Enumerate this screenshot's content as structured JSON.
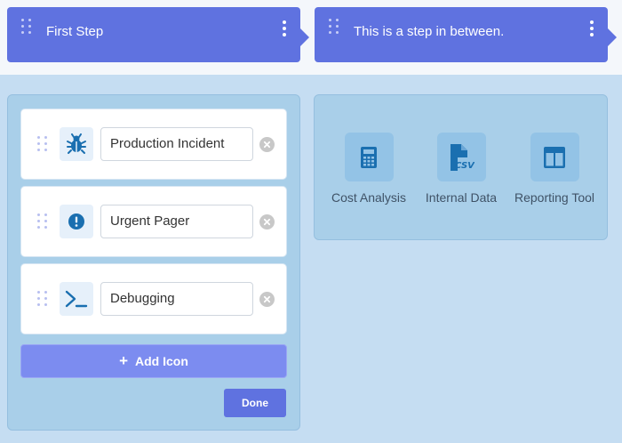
{
  "steps": [
    {
      "label": "First Step"
    },
    {
      "label": "This is a step in between."
    }
  ],
  "icon_list": {
    "items": [
      {
        "icon": "bug-icon",
        "value": "Production Incident"
      },
      {
        "icon": "exclamation-circle-icon",
        "value": "Urgent Pager"
      },
      {
        "icon": "terminal-icon",
        "value": "Debugging"
      }
    ],
    "add_label": "Add Icon",
    "done_label": "Done"
  },
  "tools": [
    {
      "icon": "calculator-icon",
      "label": "Cost Analysis"
    },
    {
      "icon": "csv-file-icon",
      "label": "Internal Data"
    },
    {
      "icon": "table-icon",
      "label": "Reporting Tool"
    }
  ],
  "colors": {
    "accent": "#5f72e0",
    "add_button": "#7c8cf0",
    "icon_blue": "#1a6fb0",
    "panel": "#a9cfe9",
    "background": "#c5ddf2"
  }
}
